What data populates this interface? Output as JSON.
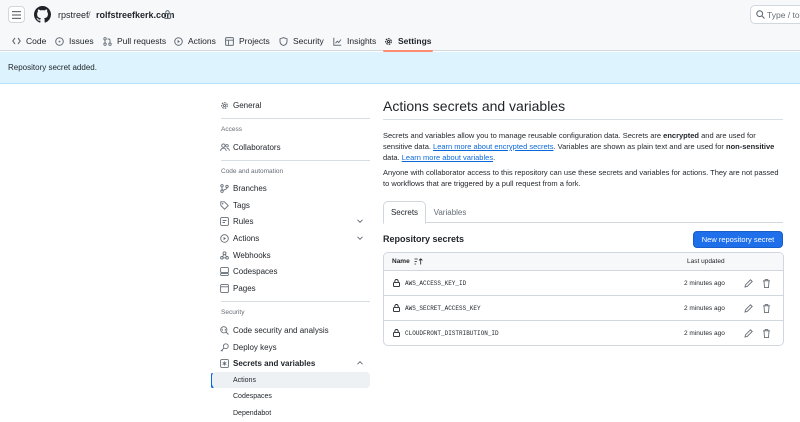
{
  "header": {
    "owner": "rpstreef",
    "separator": "/",
    "repo": "rolfstreefkerk.com",
    "search_placeholder": "Type / to"
  },
  "nav_tabs": [
    {
      "label": "Code",
      "icon": "code-icon"
    },
    {
      "label": "Issues",
      "icon": "issue-icon"
    },
    {
      "label": "Pull requests",
      "icon": "pull-request-icon"
    },
    {
      "label": "Actions",
      "icon": "play-icon"
    },
    {
      "label": "Projects",
      "icon": "table-icon"
    },
    {
      "label": "Security",
      "icon": "shield-icon"
    },
    {
      "label": "Insights",
      "icon": "graph-icon"
    },
    {
      "label": "Settings",
      "icon": "gear-icon",
      "active": true
    }
  ],
  "flash": {
    "message": "Repository secret added."
  },
  "sidebar": {
    "general": "General",
    "access_heading": "Access",
    "collaborators": "Collaborators",
    "code_heading": "Code and automation",
    "branches": "Branches",
    "tags": "Tags",
    "rules": "Rules",
    "actions": "Actions",
    "webhooks": "Webhooks",
    "codespaces": "Codespaces",
    "pages": "Pages",
    "security_heading": "Security",
    "code_security": "Code security and analysis",
    "deploy_keys": "Deploy keys",
    "secrets_vars": "Secrets and variables",
    "sub_actions": "Actions",
    "sub_codespaces": "Codespaces",
    "sub_dependabot": "Dependabot"
  },
  "main": {
    "title": "Actions secrets and variables",
    "p1": {
      "t1": "Secrets and variables allow you to manage reusable configuration data. Secrets are ",
      "b1": "encrypted",
      "t2": " and are used for sensitive data. ",
      "link1": "Learn more about encrypted secrets",
      "t3": ". Variables are shown as plain text and are used for ",
      "b2": "non-sensitive",
      "t4": " data. ",
      "link2": "Learn more about variables",
      "t5": "."
    },
    "p2": "Anyone with collaborator access to this repository can use these secrets and variables for actions. They are not passed to workflows that are triggered by a pull request from a fork.",
    "tab_secrets": "Secrets",
    "tab_variables": "Variables",
    "section_title": "Repository secrets",
    "new_button": "New repository secret",
    "col_name": "Name",
    "col_updated": "Last updated",
    "secrets": [
      {
        "name": "AWS_ACCESS_KEY_ID",
        "updated": "2 minutes ago"
      },
      {
        "name": "AWS_SECRET_ACCESS_KEY",
        "updated": "2 minutes ago"
      },
      {
        "name": "CLOUDFRONT_DISTRIBUTION_ID",
        "updated": "2 minutes ago"
      }
    ]
  },
  "colors": {
    "accent": "#0969da",
    "button": "#1f6feb",
    "flash_bg": "#ddf4ff",
    "tab_underline": "#fd8c73"
  }
}
